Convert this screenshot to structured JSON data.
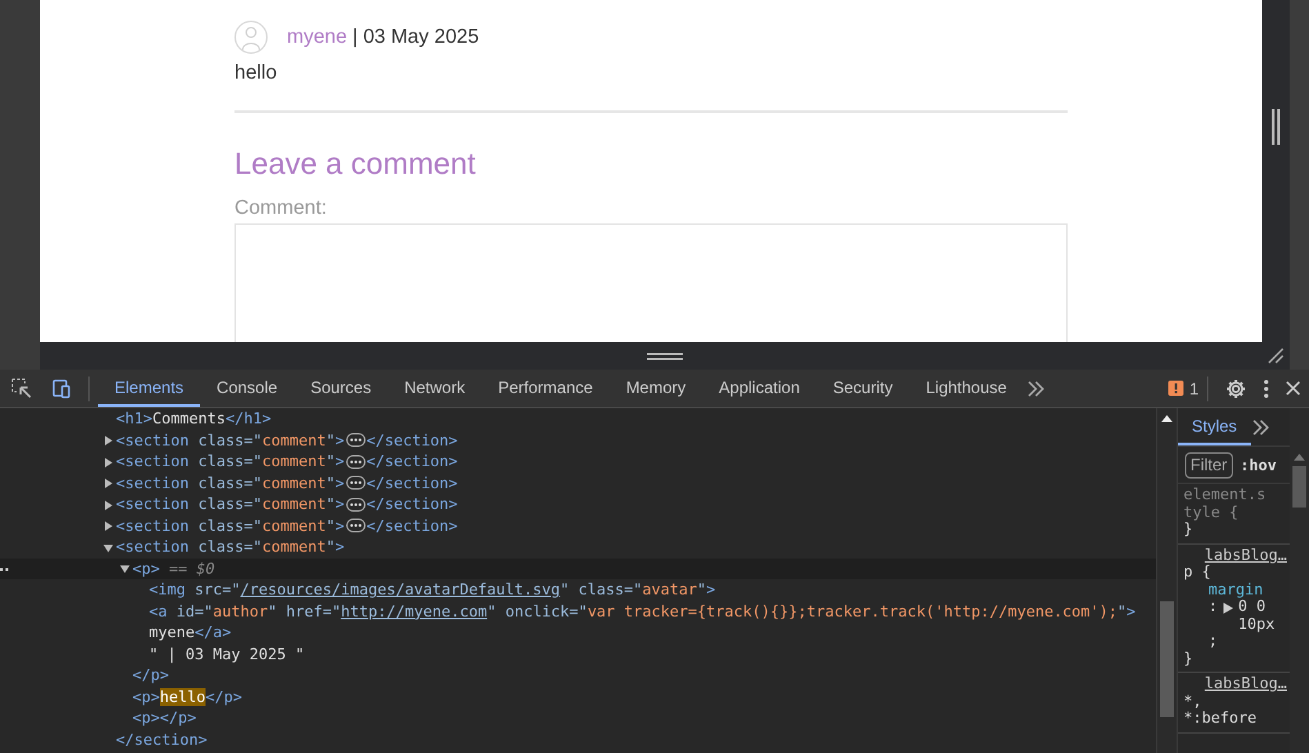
{
  "page": {
    "author": "myene",
    "date": "| 03 May 2025",
    "body": "hello",
    "heading": "Leave a comment",
    "comment_label": "Comment:"
  },
  "devtools": {
    "tabs": [
      {
        "label": "Elements",
        "selected": true
      },
      {
        "label": "Console",
        "selected": false
      },
      {
        "label": "Sources",
        "selected": false
      },
      {
        "label": "Network",
        "selected": false
      },
      {
        "label": "Performance",
        "selected": false
      },
      {
        "label": "Memory",
        "selected": false
      },
      {
        "label": "Application",
        "selected": false
      },
      {
        "label": "Security",
        "selected": false
      },
      {
        "label": "Lighthouse",
        "selected": false
      }
    ],
    "warning_count": "1",
    "dom_tree": [
      {
        "selected": false,
        "tokens": [
          {
            "kind": "tag",
            "text": "<h1>"
          },
          {
            "kind": "text",
            "text": "Comments"
          },
          {
            "kind": "tag",
            "text": "</h1>"
          }
        ]
      },
      {
        "expanded": false,
        "selected": false,
        "tokens": [
          {
            "kind": "tag",
            "text": "<section"
          },
          {
            "kind": "attr",
            "text": " class=\""
          },
          {
            "kind": "value",
            "text": "comment"
          },
          {
            "kind": "attr",
            "text": "\""
          },
          {
            "kind": "tag",
            "text": ">"
          }
        ],
        "close": [
          {
            "kind": "tag",
            "text": "</section>"
          }
        ]
      },
      {
        "expanded": false,
        "selected": false,
        "tokens": [
          {
            "kind": "tag",
            "text": "<section"
          },
          {
            "kind": "attr",
            "text": " class=\""
          },
          {
            "kind": "value",
            "text": "comment"
          },
          {
            "kind": "attr",
            "text": "\""
          },
          {
            "kind": "tag",
            "text": ">"
          }
        ],
        "close": [
          {
            "kind": "tag",
            "text": "</section>"
          }
        ]
      },
      {
        "expanded": false,
        "selected": false,
        "tokens": [
          {
            "kind": "tag",
            "text": "<section"
          },
          {
            "kind": "attr",
            "text": " class=\""
          },
          {
            "kind": "value",
            "text": "comment"
          },
          {
            "kind": "attr",
            "text": "\""
          },
          {
            "kind": "tag",
            "text": ">"
          }
        ],
        "close": [
          {
            "kind": "tag",
            "text": "</section>"
          }
        ]
      },
      {
        "expanded": false,
        "selected": false,
        "tokens": [
          {
            "kind": "tag",
            "text": "<section"
          },
          {
            "kind": "attr",
            "text": " class=\""
          },
          {
            "kind": "value",
            "text": "comment"
          },
          {
            "kind": "attr",
            "text": "\""
          },
          {
            "kind": "tag",
            "text": ">"
          }
        ],
        "close": [
          {
            "kind": "tag",
            "text": "</section>"
          }
        ]
      },
      {
        "expanded": false,
        "selected": false,
        "tokens": [
          {
            "kind": "tag",
            "text": "<section"
          },
          {
            "kind": "attr",
            "text": " class=\""
          },
          {
            "kind": "value",
            "text": "comment"
          },
          {
            "kind": "attr",
            "text": "\""
          },
          {
            "kind": "tag",
            "text": ">"
          }
        ],
        "close": [
          {
            "kind": "tag",
            "text": "</section>"
          }
        ]
      },
      {
        "expanded": true,
        "selected": false,
        "tokens": [
          {
            "kind": "tag",
            "text": "<section"
          },
          {
            "kind": "attr",
            "text": " class=\""
          },
          {
            "kind": "value",
            "text": "comment"
          },
          {
            "kind": "attr",
            "text": "\""
          },
          {
            "kind": "tag",
            "text": ">"
          }
        ],
        "children": [
          {
            "expanded": true,
            "selected": true,
            "tokens": [
              {
                "kind": "tag",
                "text": "<p>"
              },
              {
                "kind": "marker",
                "text": " == $0"
              }
            ],
            "children": [
              {
                "selected": false,
                "tokens": [
                  {
                    "kind": "tag",
                    "text": "<img"
                  },
                  {
                    "kind": "attr",
                    "text": " src=\""
                  },
                  {
                    "kind": "link",
                    "text": "/resources/images/avatarDefault.svg"
                  },
                  {
                    "kind": "attr",
                    "text": "\" class=\""
                  },
                  {
                    "kind": "value",
                    "text": "avatar"
                  },
                  {
                    "kind": "attr",
                    "text": "\""
                  },
                  {
                    "kind": "tag",
                    "text": ">"
                  }
                ]
              },
              {
                "selected": false,
                "tokens": [
                  {
                    "kind": "tag",
                    "text": "<a"
                  },
                  {
                    "kind": "attr",
                    "text": " id=\""
                  },
                  {
                    "kind": "value",
                    "text": "author"
                  },
                  {
                    "kind": "attr",
                    "text": "\" href=\""
                  },
                  {
                    "kind": "link",
                    "text": "http://myene.com"
                  },
                  {
                    "kind": "attr",
                    "text": "\" onclick=\""
                  },
                  {
                    "kind": "value",
                    "text": "var tracker={track(){}};tracker.track('http://myene.com');"
                  },
                  {
                    "kind": "attr",
                    "text": "\""
                  },
                  {
                    "kind": "tag",
                    "text": ">"
                  }
                ]
              },
              {
                "selected": false,
                "tokens": [
                  {
                    "kind": "text",
                    "text": "myene"
                  },
                  {
                    "kind": "tag",
                    "text": "</a>"
                  }
                ]
              },
              {
                "selected": false,
                "tokens": [
                  {
                    "kind": "text",
                    "text": "\" | 03 May 2025 \""
                  }
                ]
              }
            ],
            "close": [
              {
                "kind": "tag",
                "text": "</p>"
              }
            ]
          },
          {
            "selected": false,
            "tokens": [
              {
                "kind": "tag",
                "text": "<p>"
              },
              {
                "kind": "match",
                "text": "hello"
              },
              {
                "kind": "tag",
                "text": "</p>"
              }
            ]
          },
          {
            "selected": false,
            "tokens": [
              {
                "kind": "tag",
                "text": "<p></p>"
              }
            ]
          }
        ],
        "close": [
          {
            "kind": "tag",
            "text": "</section>"
          }
        ]
      }
    ],
    "styles": {
      "tabs": [
        {
          "label": "Styles",
          "selected": true
        }
      ],
      "filter": {
        "placeholder": "Filter"
      },
      "hov": ":hov",
      "rules": [
        {
          "kind": "inline",
          "selectors": [
            "element.style {"
          ],
          "close": "}"
        },
        {
          "kind": "stylesheet",
          "source": "labsBlog…",
          "selectors": [
            "p {"
          ],
          "declarations": [
            {
              "name": "margin",
              "colon": ":",
              "expandable": true,
              "value": "0 0 10px",
              "semicolon": ";"
            }
          ],
          "close": "}"
        },
        {
          "kind": "stylesheet",
          "source": "labsBlog…",
          "selectors": [
            "*,",
            "*:before"
          ]
        }
      ]
    }
  }
}
